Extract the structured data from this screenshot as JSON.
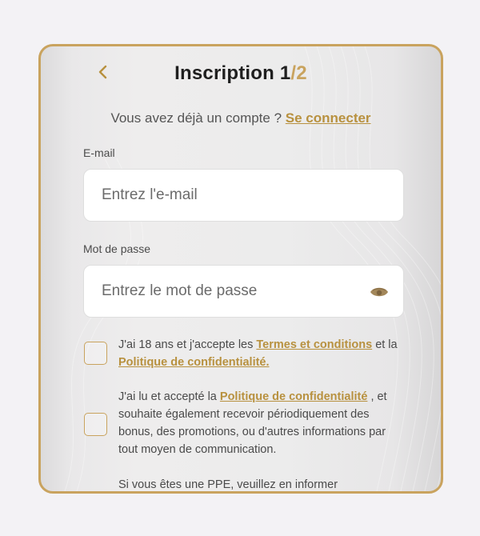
{
  "header": {
    "title_prefix": "Inscription 1",
    "title_sep": "/",
    "title_total": "2"
  },
  "login": {
    "question": "Vous avez déjà un compte ?",
    "link": "Se connecter"
  },
  "email": {
    "label": "E-mail",
    "placeholder": "Entrez l'e-mail",
    "value": ""
  },
  "password": {
    "label": "Mot de passe",
    "placeholder": "Entrez le mot de passe",
    "value": ""
  },
  "consent_terms": {
    "text_1": "J'ai 18 ans et j'accepte les",
    "link_1": "Termes et conditions",
    "text_2": "et la",
    "link_2": "Politique de confidentialité.",
    "checked": false
  },
  "consent_marketing": {
    "text_1": "J'ai lu et accepté la",
    "link_1": "Politique de confidentialité",
    "text_2": ", et souhaite également recevoir périodiquement des bonus, des promotions, ou d'autres informations par tout moyen de communication.",
    "checked": false
  },
  "ppe_notice": {
    "text": "Si vous êtes une PPE, veuillez en informer"
  },
  "colors": {
    "accent": "#c9a35e",
    "link": "#b8913f",
    "background": "#f3f2f5"
  }
}
